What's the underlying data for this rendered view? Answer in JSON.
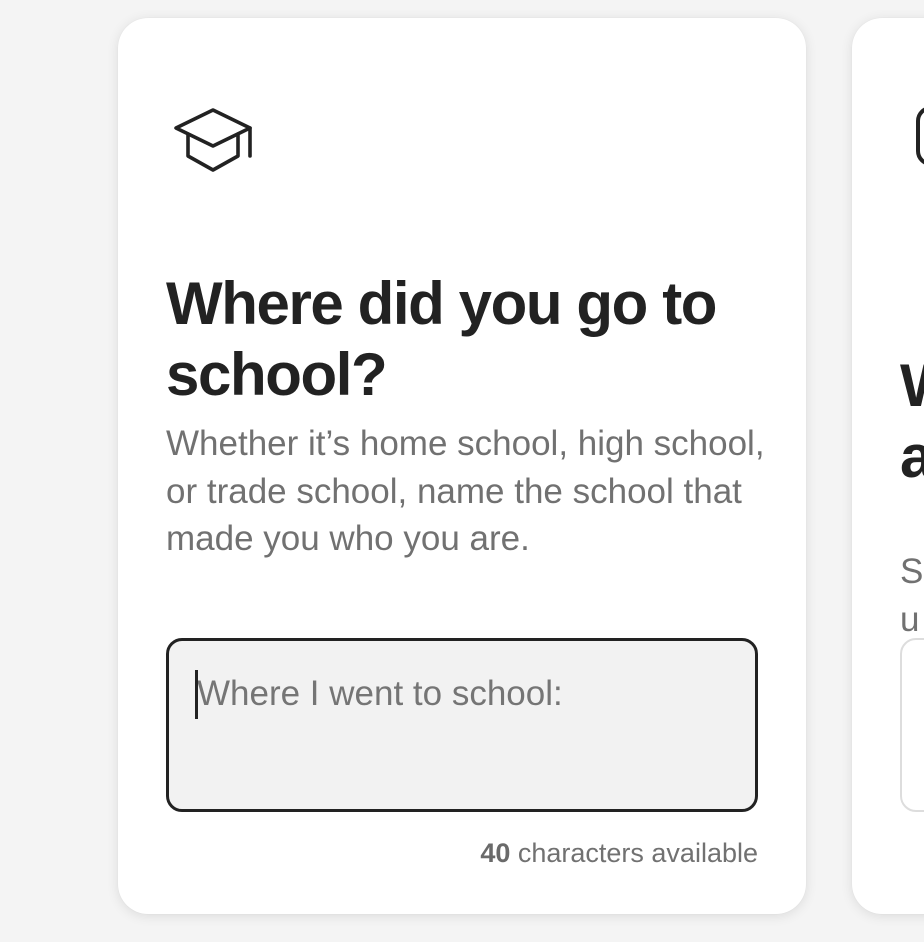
{
  "prompt_card": {
    "icon": "graduation-cap-icon",
    "title": "Where did you go to school?",
    "description": "Whether it’s home school, high school, or trade school, name the school that made you who you are.",
    "input": {
      "value": "",
      "placeholder": "Where I went to school:"
    },
    "counter": {
      "count": "40",
      "suffix": " characters available"
    }
  },
  "next_card": {
    "icon": "partial-icon",
    "title_fragment": "W\na",
    "description_fragment": "Sl\nu"
  },
  "colors": {
    "background": "#f4f4f4",
    "card": "#ffffff",
    "text_primary": "#222222",
    "text_secondary": "#717171",
    "field_background": "#f2f2f2",
    "field_border_active": "#222222"
  }
}
